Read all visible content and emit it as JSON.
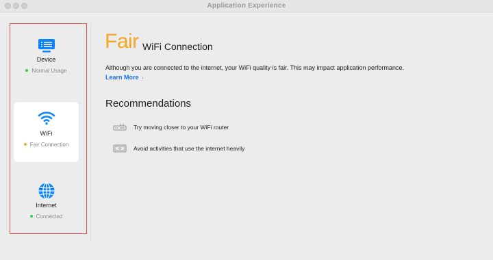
{
  "window": {
    "title": "Application Experience"
  },
  "sidebar": {
    "items": [
      {
        "label": "Device",
        "status": "Normal Usage",
        "status_color": "#34c759",
        "icon": "monitor-icon",
        "selected": false
      },
      {
        "label": "WiFi",
        "status": "Fair Connection",
        "status_color": "#f5a623",
        "icon": "wifi-icon",
        "selected": true
      },
      {
        "label": "Internet",
        "status": "Connected",
        "status_color": "#34c759",
        "icon": "globe-icon",
        "selected": false
      }
    ]
  },
  "main": {
    "rating": "Fair",
    "rating_color": "#f5a623",
    "subject": "WiFi Connection",
    "description": "Although you are connected to the internet, your WiFi quality is fair. This may impact application performance.",
    "learn_more": "Learn More",
    "learn_more_chevron": "›",
    "recommendations_title": "Recommendations",
    "recommendations": [
      {
        "icon": "router-icon",
        "text": "Try moving closer to your WiFi router"
      },
      {
        "icon": "laptop-wifi-icon",
        "text": "Avoid activities that use the internet heavily"
      }
    ]
  },
  "colors": {
    "accent_blue": "#1a73e8",
    "icon_blue": "#0a84ff"
  }
}
